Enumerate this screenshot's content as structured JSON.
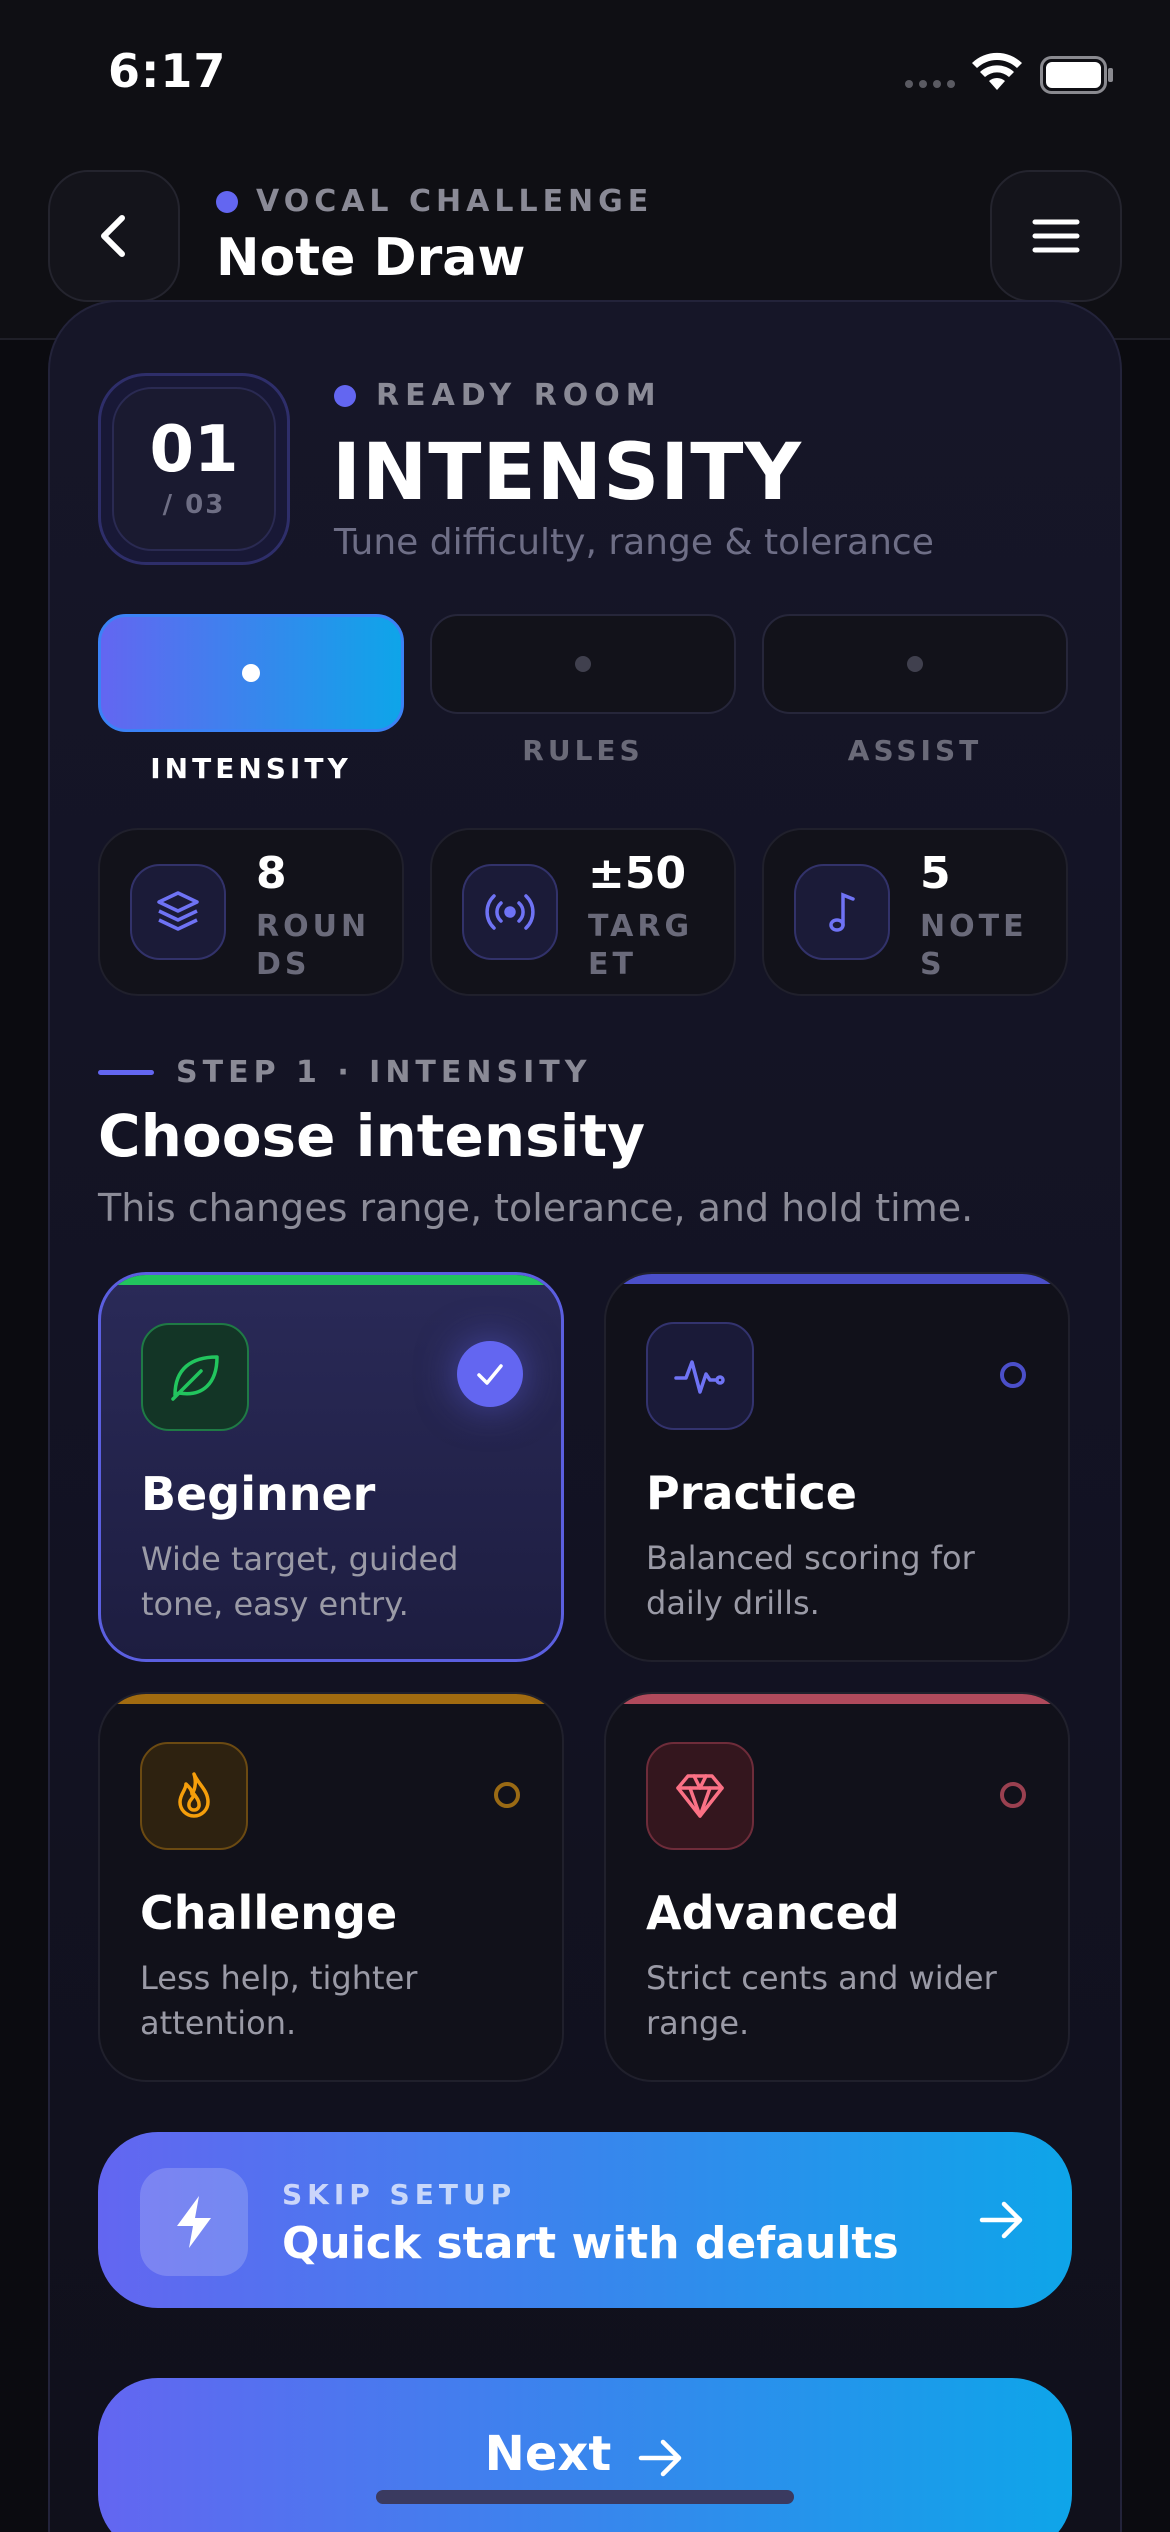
{
  "status_bar": {
    "time": "6:17"
  },
  "header": {
    "kicker": "VOCAL CHALLENGE",
    "title": "Note Draw"
  },
  "step": {
    "number": "01",
    "total": "/ 03",
    "kicker": "READY ROOM",
    "title": "INTENSITY",
    "subtitle": "Tune difficulty, range & tolerance"
  },
  "tabs": [
    {
      "label": "INTENSITY",
      "active": true
    },
    {
      "label": "RULES",
      "active": false
    },
    {
      "label": "ASSIST",
      "active": false
    }
  ],
  "stats": [
    {
      "value": "8",
      "label": "ROUNDS",
      "icon": "layers-icon"
    },
    {
      "value": "±50",
      "label": "TARGET",
      "icon": "broadcast-icon"
    },
    {
      "value": "5",
      "label": "NOTES",
      "icon": "music-note-icon"
    }
  ],
  "section": {
    "kicker": "STEP 1 · INTENSITY",
    "title": "Choose intensity",
    "subtitle": "This changes range, tolerance, and hold time."
  },
  "options": [
    {
      "title": "Beginner",
      "desc": "Wide target, guided tone, easy entry.",
      "selected": true,
      "icon": "leaf-icon",
      "color": "#22c55e"
    },
    {
      "title": "Practice",
      "desc": "Balanced scoring for daily drills.",
      "selected": false,
      "icon": "pulse-icon",
      "color": "#6366f1"
    },
    {
      "title": "Challenge",
      "desc": "Less help, tighter attention.",
      "selected": false,
      "icon": "flame-icon",
      "color": "#f59e0b"
    },
    {
      "title": "Advanced",
      "desc": "Strict cents and wider range.",
      "selected": false,
      "icon": "diamond-icon",
      "color": "#fb7185"
    }
  ],
  "quick_start": {
    "kicker": "SKIP SETUP",
    "label": "Quick start with defaults",
    "icon": "lightning-icon"
  },
  "next_button": {
    "label": "Next"
  }
}
